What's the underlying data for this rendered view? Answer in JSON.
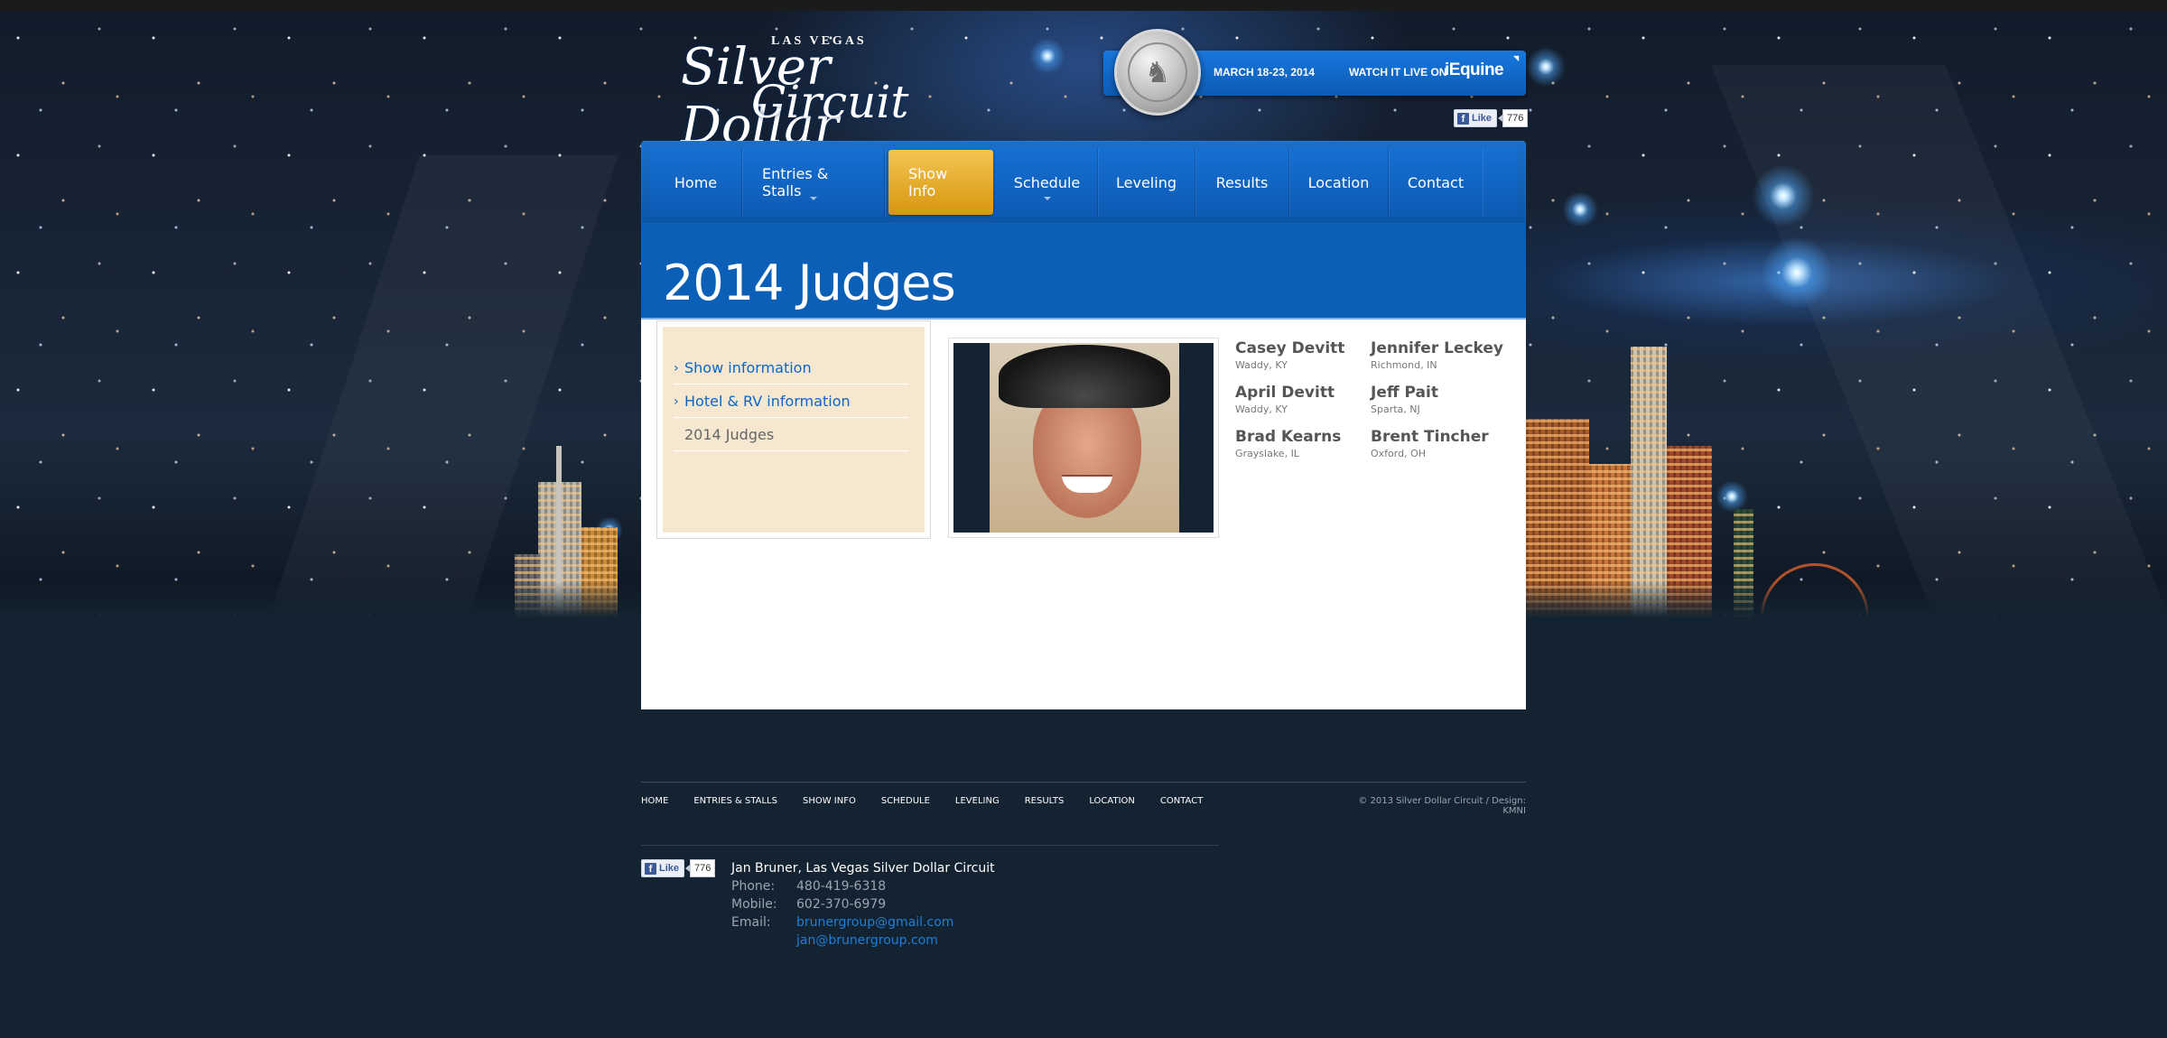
{
  "header": {
    "logo_top": "LAS VEGAS",
    "logo_line1": "Silver Dollar",
    "logo_line2": "Circuit",
    "dates": "MARCH 18-23, 2014",
    "watch_label": "WATCH IT LIVE ON",
    "watch_brand": "iEquine"
  },
  "like_widget": {
    "label": "Like",
    "count": "776"
  },
  "nav": {
    "items": [
      {
        "label": "Home"
      },
      {
        "label": "Entries & Stalls"
      },
      {
        "label": "Show Info"
      },
      {
        "label": "Schedule"
      },
      {
        "label": "Leveling"
      },
      {
        "label": "Results"
      },
      {
        "label": "Location"
      },
      {
        "label": "Contact"
      }
    ]
  },
  "page": {
    "title": "2014 Judges"
  },
  "sidebar": {
    "items": [
      {
        "label": "Show information"
      },
      {
        "label": "Hotel & RV information"
      },
      {
        "label": "2014 Judges"
      }
    ]
  },
  "judges": [
    {
      "name": "Casey Devitt",
      "location": "Waddy, KY"
    },
    {
      "name": "Jennifer Leckey",
      "location": "Richmond, IN"
    },
    {
      "name": "April Devitt",
      "location": "Waddy, KY"
    },
    {
      "name": "Jeff Pait",
      "location": "Sparta, NJ"
    },
    {
      "name": "Brad Kearns",
      "location": "Grayslake, IL"
    },
    {
      "name": "Brent Tincher",
      "location": "Oxford, OH"
    }
  ],
  "footer": {
    "nav": [
      "HOME",
      "ENTRIES & STALLS",
      "SHOW INFO",
      "SCHEDULE",
      "LEVELING",
      "RESULTS",
      "LOCATION",
      "CONTACT"
    ],
    "copyright": "© 2013 Silver Dollar Circuit  /  Design: KMNI",
    "contact": {
      "name": "Jan Bruner, Las Vegas Silver Dollar Circuit",
      "phone_label": "Phone:",
      "phone": "480-419-6318",
      "mobile_label": "Mobile:",
      "mobile": "602-370-6979",
      "email_label": "Email:",
      "email1": "brunergroup@gmail.com",
      "email2": "jan@brunergroup.com"
    }
  },
  "colors": {
    "nav_blue": "#0b5fb7",
    "active_gold": "#e3a62a",
    "footer_bg": "#132331",
    "sidebar_bg": "#f5e7d0"
  }
}
